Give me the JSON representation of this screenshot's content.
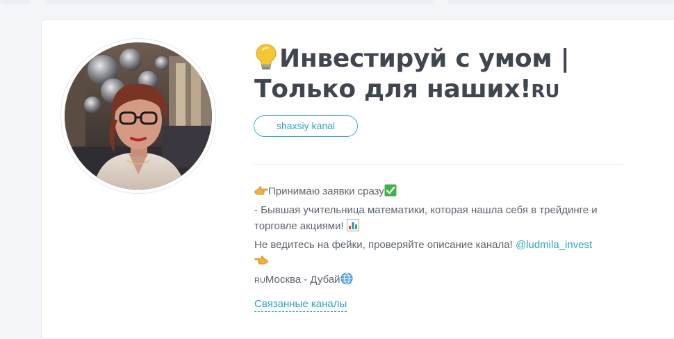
{
  "channel": {
    "title_line1": "Инвестируй с умом |",
    "title_line2": "Только для наших!",
    "title_flag": "RU",
    "tag_label": "shaxsiy kanal",
    "description": {
      "line1": "Принимаю заявки сразу",
      "line2": "- Бывшая учительница математики, которая нашла себя в трейдинге и",
      "line3": "торговле акциями!",
      "line4_text": "Не ведитесь на фейки, проверяйте описание канала!",
      "line4_link": "@ludmila_invest",
      "line6_flag": "RU",
      "line6_text": "Москва - Дубай"
    },
    "related_label": "Связанные каналы"
  },
  "colors": {
    "accent": "#2ca6c4",
    "title": "#3f4650",
    "text": "#5d646d",
    "background": "#f4f5f9",
    "card": "#ffffff"
  },
  "icons": {
    "title_prefix": "lightbulb-icon",
    "line1_prefix": "pointing-right-hand-icon",
    "line1_suffix": "check-mark-icon",
    "line3_suffix": "bar-chart-icon",
    "line5": "pointing-left-hand-icon",
    "line6_suffix": "globe-icon"
  }
}
